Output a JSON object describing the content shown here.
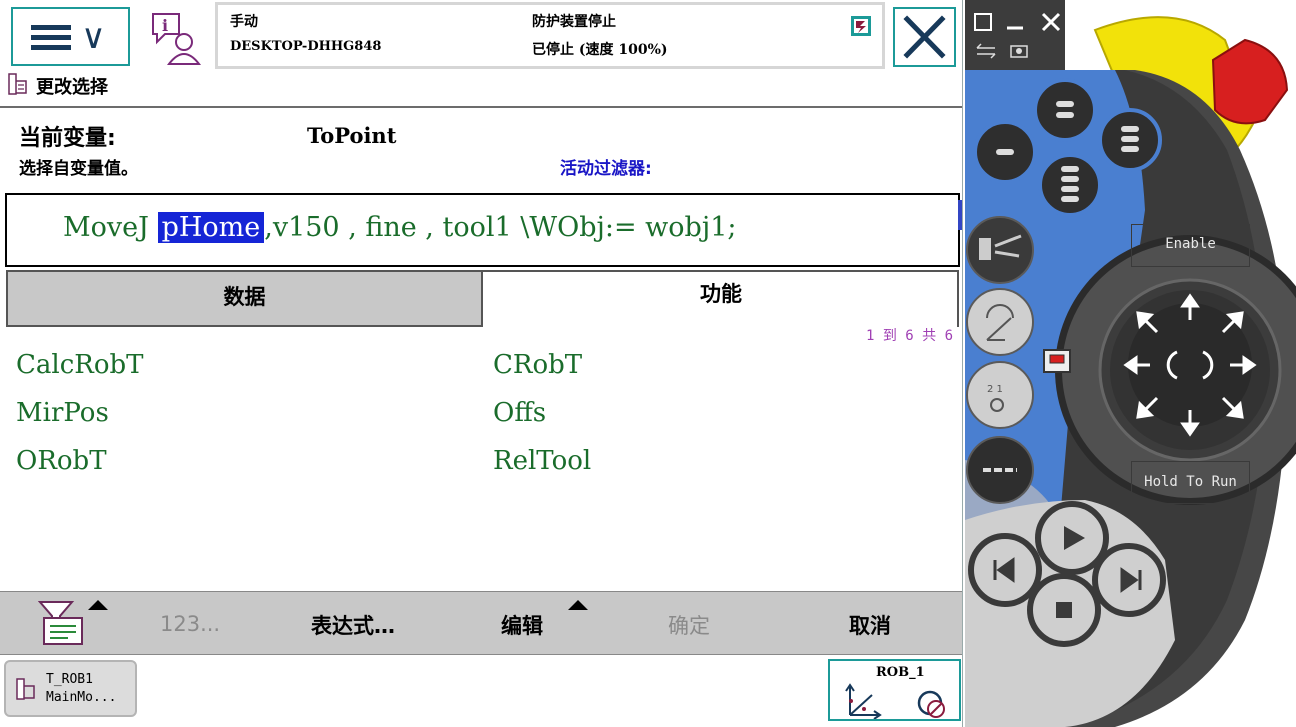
{
  "header": {
    "mode": "手动",
    "host": "DESKTOP-DHHG848",
    "guard_state": "防护装置停止",
    "run_state": "已停止 (速度 100%)"
  },
  "page": {
    "title": "更改选择",
    "current_variable_label": "当前变量:",
    "current_variable_value": "ToPoint",
    "select_hint": "选择自变量值。",
    "active_filter_label": "活动过滤器:"
  },
  "instruction": {
    "keyword": "MoveJ",
    "selected_arg": "pHome",
    "rest": ",v150 , fine , tool1 \\WObj:= wobj1;"
  },
  "tabs": [
    {
      "label": "数据",
      "active": false
    },
    {
      "label": "功能",
      "active": true
    }
  ],
  "list": {
    "paging": "1 到 6 共 6",
    "items": [
      "CalcRobT",
      "CRobT",
      "MirPos",
      "Offs",
      "ORobT",
      "RelTool"
    ]
  },
  "bottom_bar": {
    "numpad": "123...",
    "expression": "表达式…",
    "edit": "编辑",
    "ok": "确定",
    "cancel": "取消"
  },
  "taskbar": {
    "task_line1": "T_ROB1",
    "task_line2": "MainMo...",
    "robot": "ROB_1"
  },
  "device": {
    "enable_label": "Enable",
    "hold_to_run_label": "Hold To Run"
  },
  "colors": {
    "teal_accent": "#1c9a98",
    "code_green": "#1a6c2b",
    "selection_blue": "#1525d6",
    "filter_blue": "#1a16c6",
    "paging_purple": "#a040b4",
    "device_blue": "#4a7fd0",
    "estop_red": "#d71f1f",
    "estop_yellow": "#f2e20a"
  }
}
